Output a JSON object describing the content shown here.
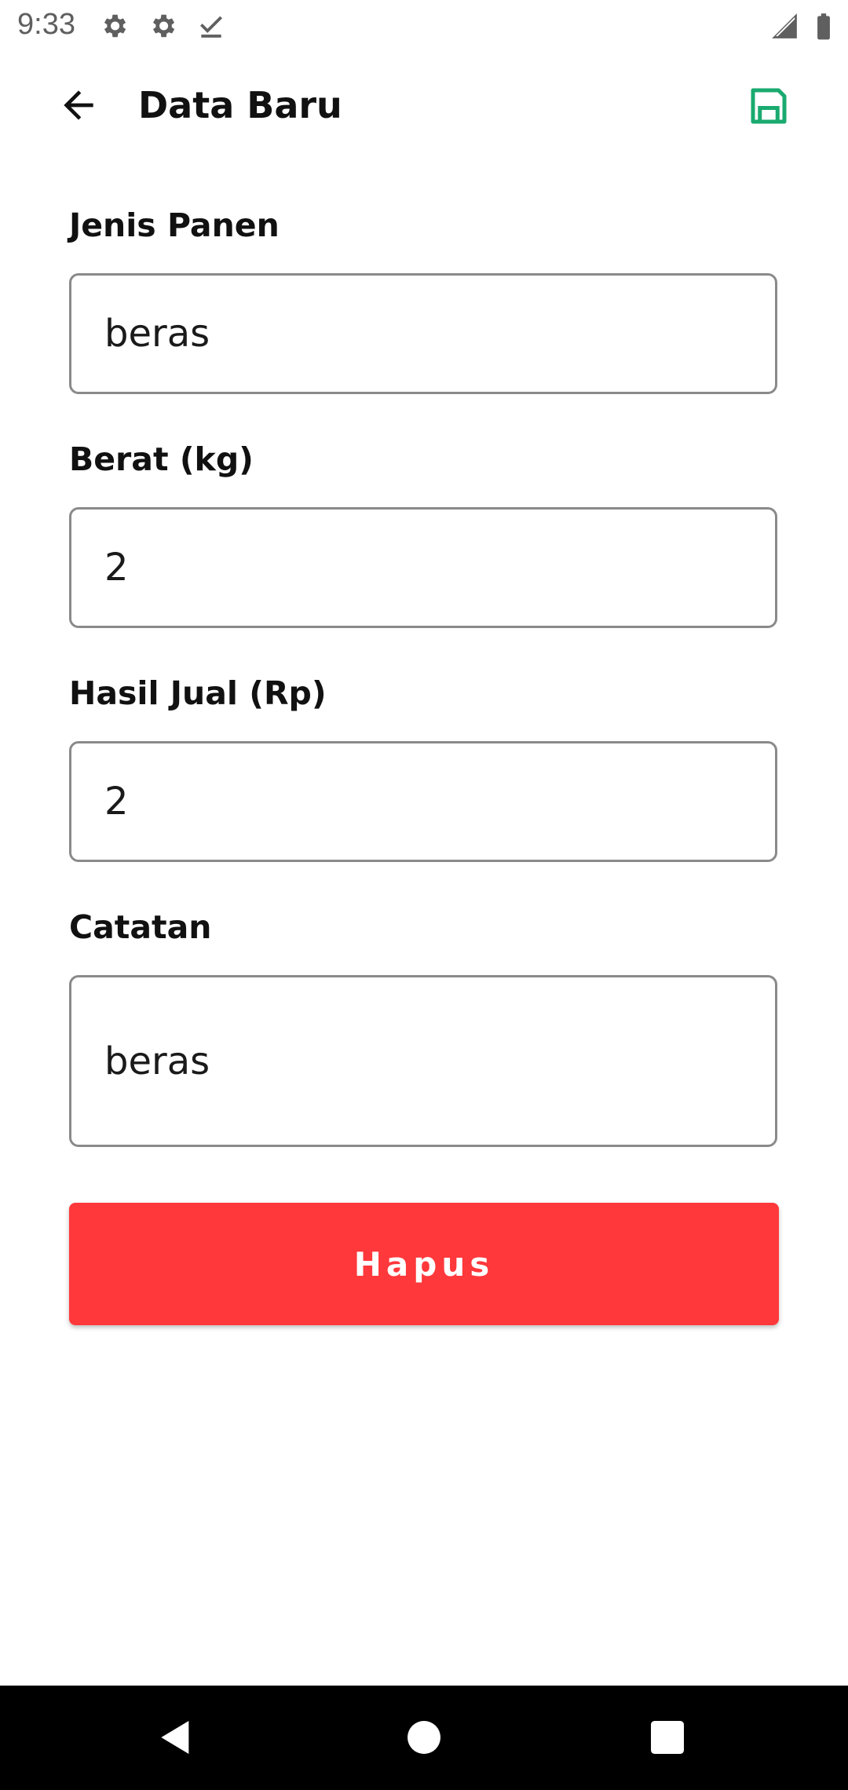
{
  "status_bar": {
    "time": "9:33",
    "icons": [
      "gear-icon",
      "gear-icon",
      "check-download-icon",
      "signal-icon",
      "battery-icon"
    ]
  },
  "app_bar": {
    "title": "Data Baru",
    "back_icon": "arrow-back-icon",
    "save_icon": "save-icon",
    "accent_color": "#1aaa6f"
  },
  "form": {
    "jenis_panen": {
      "label": "Jenis Panen",
      "value": "beras"
    },
    "berat": {
      "label": "Berat (kg)",
      "value": "2"
    },
    "hasil_jual": {
      "label": "Hasil Jual (Rp)",
      "value": "2"
    },
    "catatan": {
      "label": "Catatan",
      "value": "beras"
    }
  },
  "actions": {
    "delete_label": "Hapus",
    "delete_color": "#ff383b"
  },
  "nav_bar": {
    "icons": [
      "back-triangle-icon",
      "home-circle-icon",
      "recents-square-icon"
    ]
  }
}
